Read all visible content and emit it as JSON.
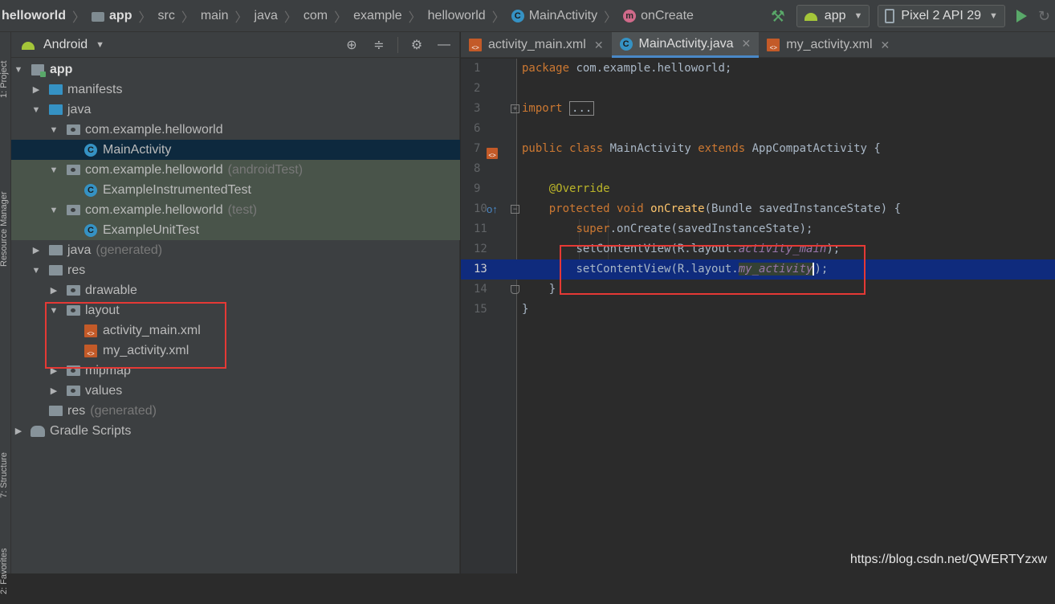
{
  "breadcrumb": {
    "items": [
      "helloworld",
      "app",
      "src",
      "main",
      "java",
      "com",
      "example",
      "helloworld",
      "MainActivity",
      "onCreate"
    ]
  },
  "toolbar": {
    "config_label": "app",
    "device_label": "Pixel 2 API 29"
  },
  "left_strip": {
    "project_tab": "1: Project",
    "resource_manager_tab": "Resource Manager",
    "structure_tab": "7: Structure",
    "favorites_tab": "2: Favorites"
  },
  "project_panel": {
    "view_mode": "Android",
    "tree": [
      {
        "label": "app",
        "suffix": ""
      },
      {
        "label": "manifests",
        "suffix": ""
      },
      {
        "label": "java",
        "suffix": ""
      },
      {
        "label": "com.example.helloworld",
        "suffix": ""
      },
      {
        "label": "MainActivity",
        "suffix": ""
      },
      {
        "label": "com.example.helloworld",
        "suffix": "(androidTest)"
      },
      {
        "label": "ExampleInstrumentedTest",
        "suffix": ""
      },
      {
        "label": "com.example.helloworld",
        "suffix": "(test)"
      },
      {
        "label": "ExampleUnitTest",
        "suffix": ""
      },
      {
        "label": "java",
        "suffix": "(generated)"
      },
      {
        "label": "res",
        "suffix": ""
      },
      {
        "label": "drawable",
        "suffix": ""
      },
      {
        "label": "layout",
        "suffix": ""
      },
      {
        "label": "activity_main.xml",
        "suffix": ""
      },
      {
        "label": "my_activity.xml",
        "suffix": ""
      },
      {
        "label": "mipmap",
        "suffix": ""
      },
      {
        "label": "values",
        "suffix": ""
      },
      {
        "label": "res",
        "suffix": "(generated)"
      },
      {
        "label": "Gradle Scripts",
        "suffix": ""
      }
    ]
  },
  "editor": {
    "tabs": [
      {
        "label": "activity_main.xml",
        "active": false
      },
      {
        "label": "MainActivity.java",
        "active": true
      },
      {
        "label": "my_activity.xml",
        "active": false
      }
    ],
    "line_numbers": [
      "1",
      "2",
      "3",
      "6",
      "7",
      "8",
      "9",
      "10",
      "11",
      "12",
      "13",
      "14",
      "15"
    ],
    "code": {
      "l1_kw": "package",
      "l1_rest": " com.example.helloworld;",
      "l3_kw": "import",
      "l3_dots": "...",
      "l7_kw1": "public",
      "l7_kw2": "class",
      "l7_name": " MainActivity ",
      "l7_kw3": "extends",
      "l7_rest": " AppCompatActivity {",
      "l9_ann": "@Override",
      "l10_kw1": "protected",
      "l10_kw2": "void",
      "l10_fn": "onCreate",
      "l10_rest": "(Bundle savedInstanceState) {",
      "l11_kw": "super",
      "l11_rest": ".onCreate(savedInstanceState);",
      "l12_a": "setContentView(R.layout.",
      "l12_fld": "activity_main",
      "l12_b": ");",
      "l13_a": "setContentView(R.layout.",
      "l13_fld": "my_activity",
      "l13_b": ");",
      "l14": "}",
      "l15": "}"
    }
  },
  "watermark": "https://blog.csdn.net/QWERTYzxw"
}
